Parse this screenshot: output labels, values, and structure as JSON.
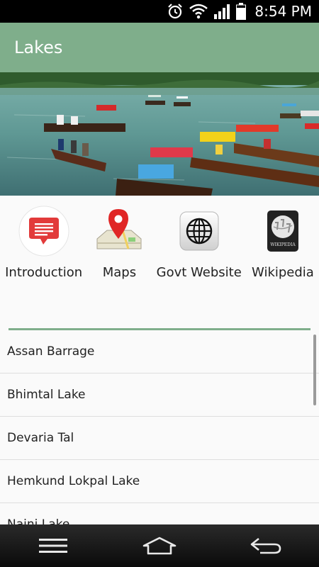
{
  "status_bar": {
    "time": "8:54 PM",
    "icons": [
      "alarm-icon",
      "wifi-icon",
      "signal-icon",
      "battery-icon"
    ]
  },
  "app_bar": {
    "title": "Lakes",
    "color": "#7fae8b"
  },
  "hero": {
    "alt": "lake-with-boats-photo"
  },
  "shortcuts": [
    {
      "label": "Introduction",
      "icon": "chat-bubble-icon"
    },
    {
      "label": "Maps",
      "icon": "map-pin-icon"
    },
    {
      "label": "Govt Website",
      "icon": "globe-icon"
    },
    {
      "label": "Wikipedia",
      "icon": "wikipedia-icon"
    }
  ],
  "lakes": [
    {
      "name": "Assan Barrage"
    },
    {
      "name": "Bhimtal Lake"
    },
    {
      "name": "Devaria Tal"
    },
    {
      "name": "Hemkund Lokpal Lake"
    },
    {
      "name": "Naini Lake"
    }
  ],
  "nav": [
    "menu-icon",
    "home-icon",
    "back-icon"
  ]
}
